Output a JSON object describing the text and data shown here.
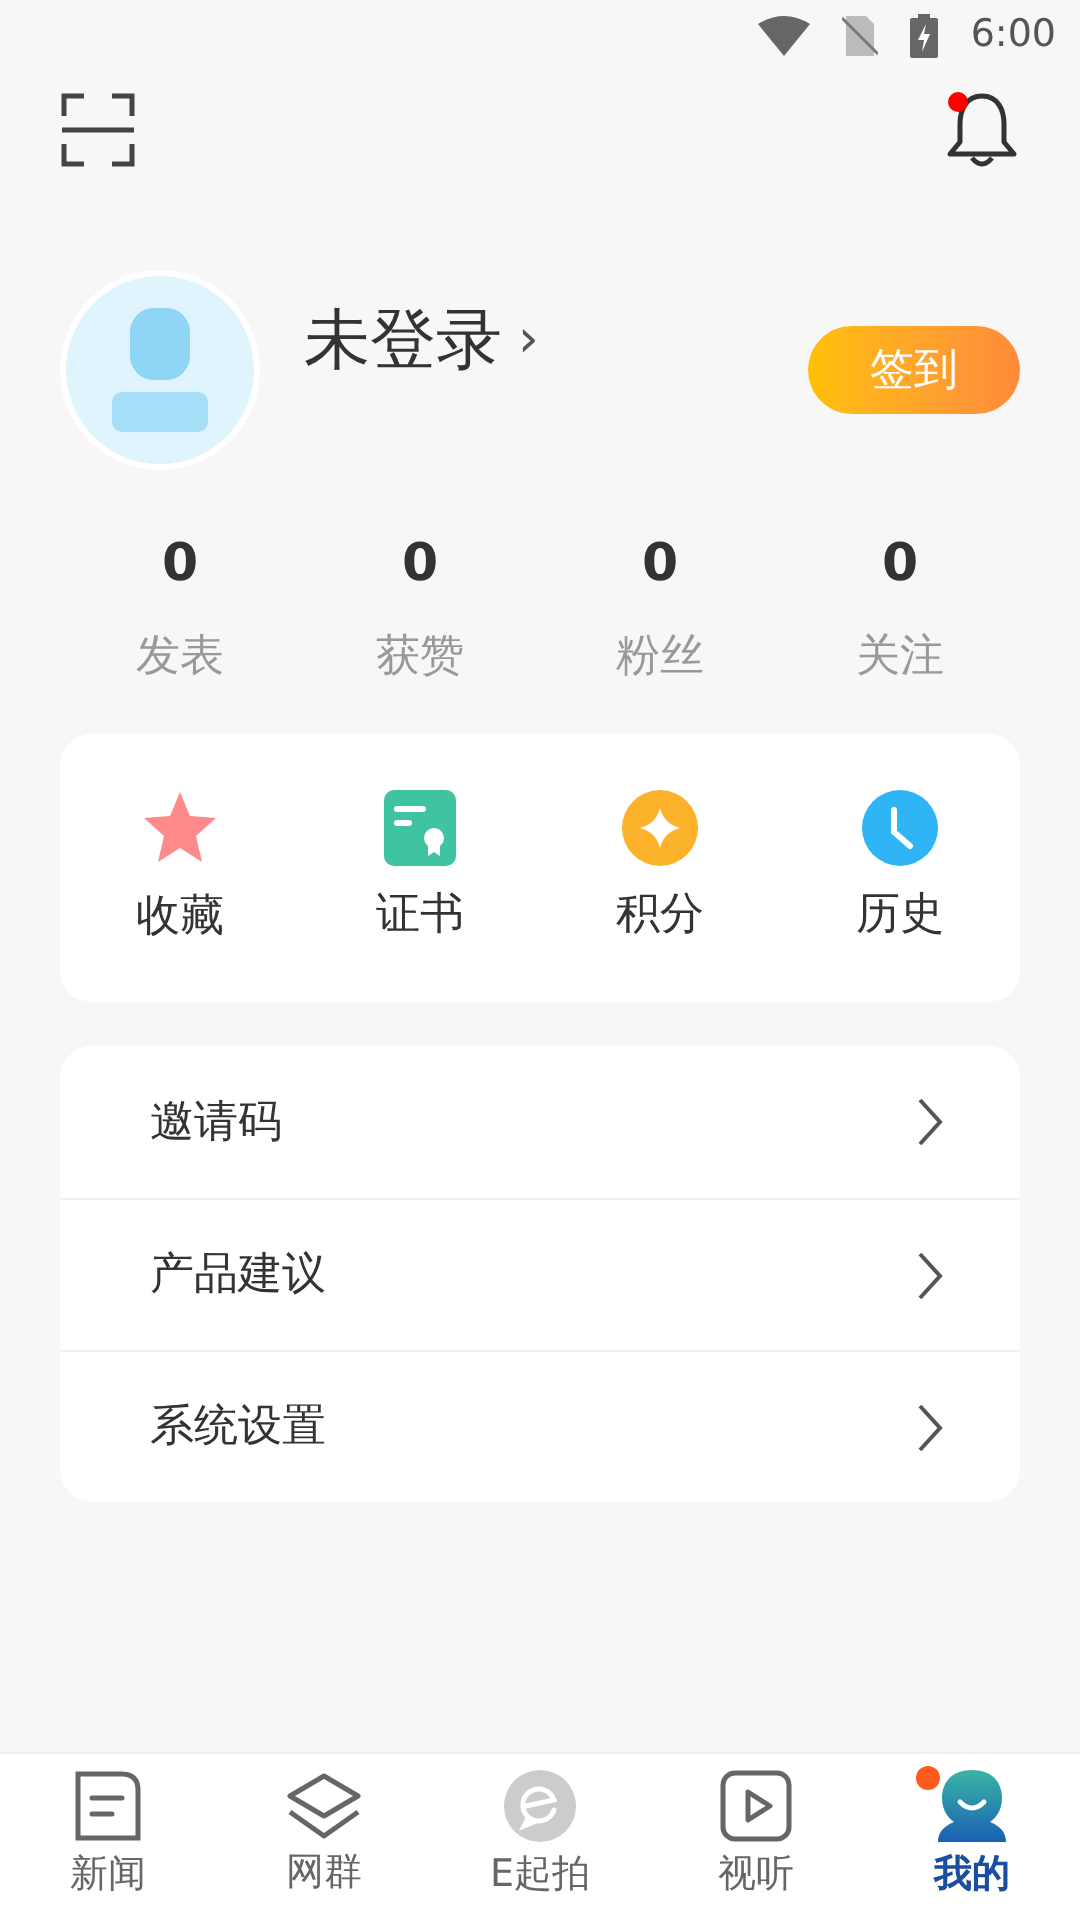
{
  "status_bar": {
    "time": "6:00"
  },
  "header": {
    "notification_dot": true
  },
  "profile": {
    "name": "未登录",
    "chevron": "›",
    "checkin_button": "签到"
  },
  "stats": [
    {
      "value": "0",
      "label": "发表"
    },
    {
      "value": "0",
      "label": "获赞"
    },
    {
      "value": "0",
      "label": "粉丝"
    },
    {
      "value": "0",
      "label": "关注"
    }
  ],
  "shortcuts": [
    {
      "kind": "star",
      "label": "收藏"
    },
    {
      "kind": "certificate",
      "label": "证书"
    },
    {
      "kind": "points",
      "label": "积分"
    },
    {
      "kind": "history",
      "label": "历史"
    }
  ],
  "menu": [
    {
      "label": "邀请码"
    },
    {
      "label": "产品建议"
    },
    {
      "label": "系统设置"
    }
  ],
  "tabs": [
    {
      "kind": "news",
      "label": "新闻",
      "selected": false,
      "badge": false
    },
    {
      "kind": "groups",
      "label": "网群",
      "selected": false,
      "badge": false
    },
    {
      "kind": "camera",
      "label": "E起拍",
      "selected": false,
      "badge": false
    },
    {
      "kind": "video",
      "label": "视听",
      "selected": false,
      "badge": false
    },
    {
      "kind": "me",
      "label": "我的",
      "selected": true,
      "badge": true
    }
  ]
}
